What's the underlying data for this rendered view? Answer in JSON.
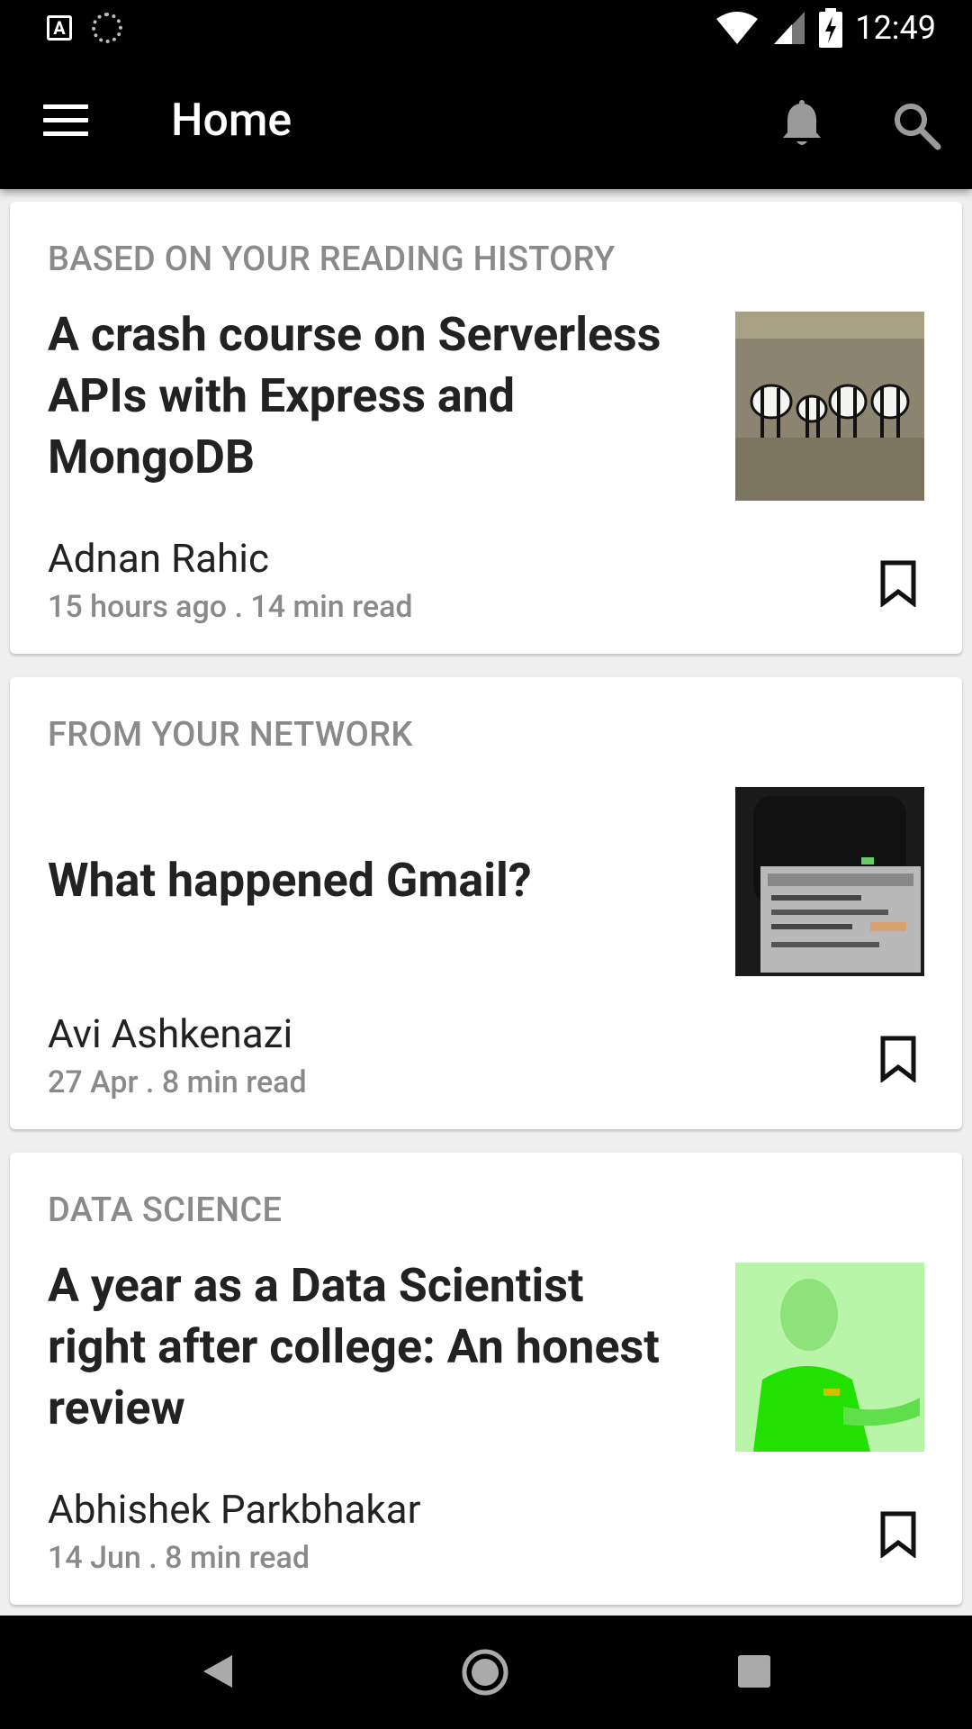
{
  "status_bar": {
    "time": "12:49",
    "left_icons": [
      "accessibility-a-icon",
      "sync-ring-icon"
    ],
    "right_icons": [
      "wifi-icon",
      "cell-signal-icon",
      "battery-charging-icon"
    ]
  },
  "app_bar": {
    "title": "Home",
    "icons": [
      "menu-icon",
      "bell-icon",
      "search-icon"
    ]
  },
  "feed": [
    {
      "category": "BASED ON YOUR READING HISTORY",
      "title": "A crash course on Serverless APIs with Express and MongoDB",
      "author": "Adnan Rahic",
      "meta": "15 hours ago . 14 min read",
      "thumbnail": "zebras-photo"
    },
    {
      "category": "FROM YOUR NETWORK",
      "title": "What happened Gmail?",
      "author": "Avi Ashkenazi",
      "meta": "27 Apr . 8 min read",
      "thumbnail": "phone-screen-photo"
    },
    {
      "category": "DATA SCIENCE",
      "title": "A year as a Data Scientist right after college: An honest review",
      "author": "Abhishek Parkbhakar",
      "meta": "14 Jun . 8 min read",
      "thumbnail": "speaker-green-photo"
    }
  ],
  "nav_bar": {
    "icons": [
      "back-icon",
      "home-icon",
      "recents-icon"
    ]
  },
  "colors": {
    "bar_background": "#000000",
    "card_background": "#ffffff",
    "page_background": "#efefef",
    "category_text": "#8a8a8a",
    "title_text": "#222222"
  }
}
